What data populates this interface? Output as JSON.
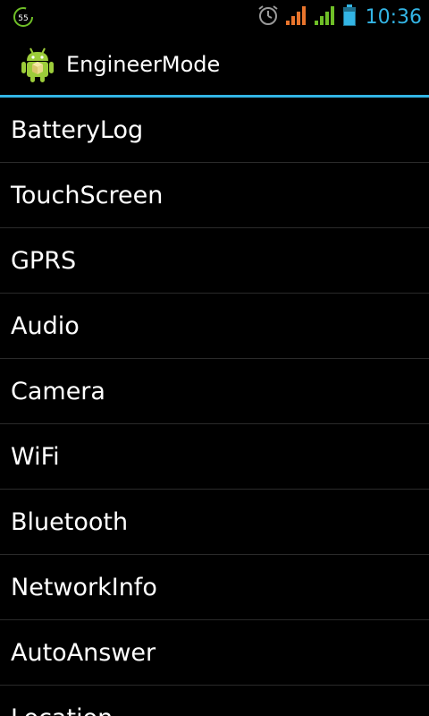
{
  "status_bar": {
    "badge_value": "55",
    "time": "10:36",
    "icons": [
      "battery-saver-badge-icon",
      "alarm-icon",
      "signal-sim1-icon",
      "signal-sim2-icon",
      "battery-icon"
    ],
    "colors": {
      "clock": "#33b5e5",
      "signal_sim1": "#e8742c",
      "signal_sim2": "#6fbf27",
      "badge": "#6fbf27"
    }
  },
  "action_bar": {
    "title": "EngineerMode",
    "icon": "android-app-icon",
    "divider_color": "#33b5e5"
  },
  "list": {
    "items": [
      {
        "label": "BatteryLog"
      },
      {
        "label": "TouchScreen"
      },
      {
        "label": "GPRS"
      },
      {
        "label": "Audio"
      },
      {
        "label": "Camera"
      },
      {
        "label": "WiFi"
      },
      {
        "label": "Bluetooth"
      },
      {
        "label": "NetworkInfo"
      },
      {
        "label": "AutoAnswer"
      },
      {
        "label": "Location"
      }
    ]
  }
}
